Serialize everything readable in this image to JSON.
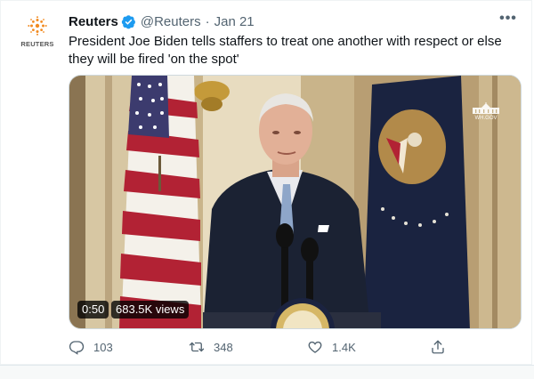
{
  "tweet": {
    "author_name": "Reuters",
    "handle": "@Reuters",
    "separator": "·",
    "date": "Jan 21",
    "avatar_text": "REUTERS",
    "text": "President Joe Biden tells staffers to treat one another with respect or else they will be fired 'on the spot'",
    "more_icon": "more-icon",
    "verified_icon": "verified-badge-icon"
  },
  "media": {
    "duration": "0:50",
    "views": "683.5K views",
    "watermark": "WH.GOV"
  },
  "actions": {
    "replies": "103",
    "retweets": "348",
    "likes": "1.4K",
    "reply_icon": "reply-icon",
    "retweet_icon": "retweet-icon",
    "like_icon": "heart-icon",
    "share_icon": "share-icon"
  },
  "colors": {
    "verified": "#1d9bf0",
    "secondary_text": "#536471",
    "primary_text": "#0f1419",
    "reuters_orange": "#f28b21"
  }
}
